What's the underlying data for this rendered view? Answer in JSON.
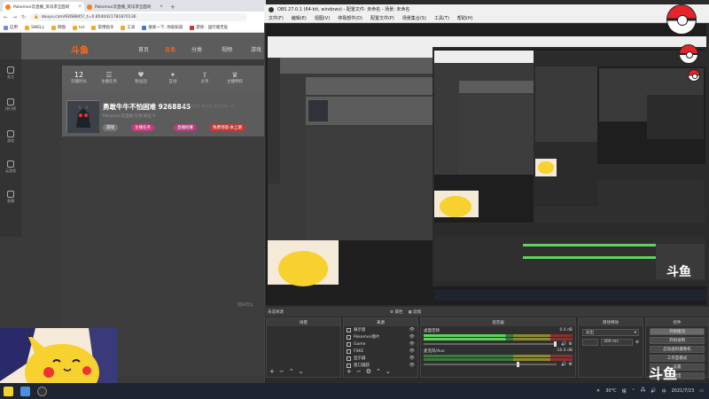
{
  "browser": {
    "tabs": [
      {
        "title": "Pokemon云直播_资讯求全面闲"
      },
      {
        "title": "Pokemon云直播_资讯求全面闲"
      }
    ],
    "new_tab": "+",
    "url": "douyu.com/9268845?_t=0.8540421781870136",
    "bookmarks": [
      "应用",
      "SWELL",
      "网盘",
      "txt",
      "常用指令",
      "工具",
      "搜索一下, 你就知道",
      "技术分享",
      "游侠 - 国行版无处"
    ]
  },
  "douyu": {
    "logo": "斗鱼",
    "nav": [
      "首页",
      "直播",
      "分类",
      "视频",
      "游戏"
    ],
    "left_items": [
      "关注",
      "排行榜",
      "游戏",
      "云游戏",
      "直播"
    ],
    "nav2": [
      {
        "value": "12",
        "label": "云播时长"
      },
      {
        "value": "",
        "label": "主播任务"
      },
      {
        "value": "",
        "label": "粉丝团"
      },
      {
        "value": "",
        "label": "互动"
      },
      {
        "value": "",
        "label": "分享"
      },
      {
        "value": "",
        "label": "主播特权"
      },
      {
        "value": "",
        "label": "主播工具"
      }
    ],
    "room_title": "勇敢牛牛不怕困难 9268845",
    "room_sub": "Pokemon云直播   在线   粉丝 9",
    "room_meta": "首播  可招待  粉丝团,单位进来一位",
    "badges": [
      "游戏",
      "主播任务",
      "直播招募",
      "免费领取·本上期"
    ],
    "watermark": "回归可以"
  },
  "obs": {
    "title": "OBS 27.0.1 (64-bit, windows) - 配置文件: 未命名 - 场景: 未命名",
    "menu": [
      "文件(F)",
      "编辑(E)",
      "视图(V)",
      "停靠部件(D)",
      "配置文件(P)",
      "场景集合(S)",
      "工具(T)",
      "帮助(H)"
    ],
    "status_left": "未选择源",
    "status_buttons": [
      "属性",
      "滤镜"
    ],
    "scenes_header": "场景",
    "sources_header": "来源",
    "sources": [
      "展示窗",
      "Pokemon图片",
      "Game",
      "FSKE",
      "显示器",
      "窗口捕获"
    ],
    "mixer_header": "混音器",
    "mixer": [
      {
        "name": "桌面音频",
        "db": "0.0 dB"
      },
      {
        "name": "麦克风/Aux",
        "db": "-10.0 dB"
      }
    ],
    "transitions_header": "转场特效",
    "transition": "淡出",
    "duration": "300 ms",
    "controls_header": "控件",
    "controls": [
      "开始推流",
      "开始录制",
      "启动虚拟摄像机",
      "工作室模式",
      "设置",
      "退出"
    ]
  },
  "taskbar": {
    "temp": "30°C",
    "weather": "晴",
    "lang": "中",
    "time": "",
    "date": "2021/7/23"
  },
  "colors": {
    "accent": "#ff6a1a",
    "obs_bg": "#2b2b2b"
  }
}
